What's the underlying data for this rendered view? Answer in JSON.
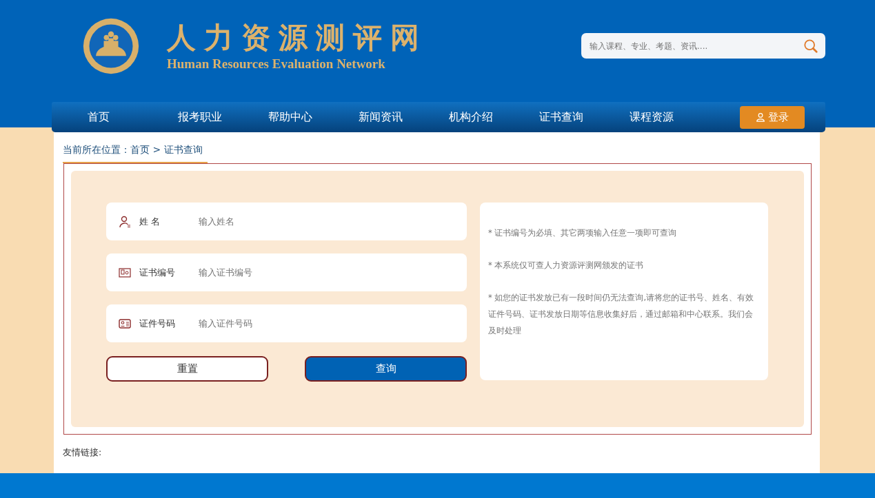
{
  "header": {
    "title": "人力资源测评网",
    "subtitle": "Human Resources Evaluation Network",
    "search": {
      "placeholder": "输入课程、专业、考题、资讯...."
    }
  },
  "nav": {
    "items": [
      "首页",
      "报考职业",
      "帮助中心",
      "新闻资讯",
      "机构介绍",
      "证书查询",
      "课程资源"
    ],
    "login": "登录"
  },
  "breadcrumb": "当前所在位置：首页 > 证书查询",
  "form": {
    "fields": [
      {
        "kind": "person",
        "label": "姓 名",
        "placeholder": "输入姓名"
      },
      {
        "kind": "certificate",
        "label": "证书编号",
        "placeholder": "输入证书编号"
      },
      {
        "kind": "idcard",
        "label": "证件号码",
        "placeholder": "输入证件号码"
      }
    ],
    "buttons": [
      {
        "kind": "secondary",
        "label": "重置"
      },
      {
        "kind": "primary",
        "label": "查询"
      }
    ]
  },
  "notes": [
    "* 证书编号为必填、其它两项输入任意一项即可查询",
    "* 本系统仅可查人力资源评测网颁发的证书",
    "* 如您的证书发放已有一段时间仍无法查询,请将您的证书号、姓名、有效证件号码、证书发放日期等信息收集好后，通过邮箱和中心联系。我们会及时处理"
  ],
  "friend_links": {
    "label": "友情链接:"
  }
}
